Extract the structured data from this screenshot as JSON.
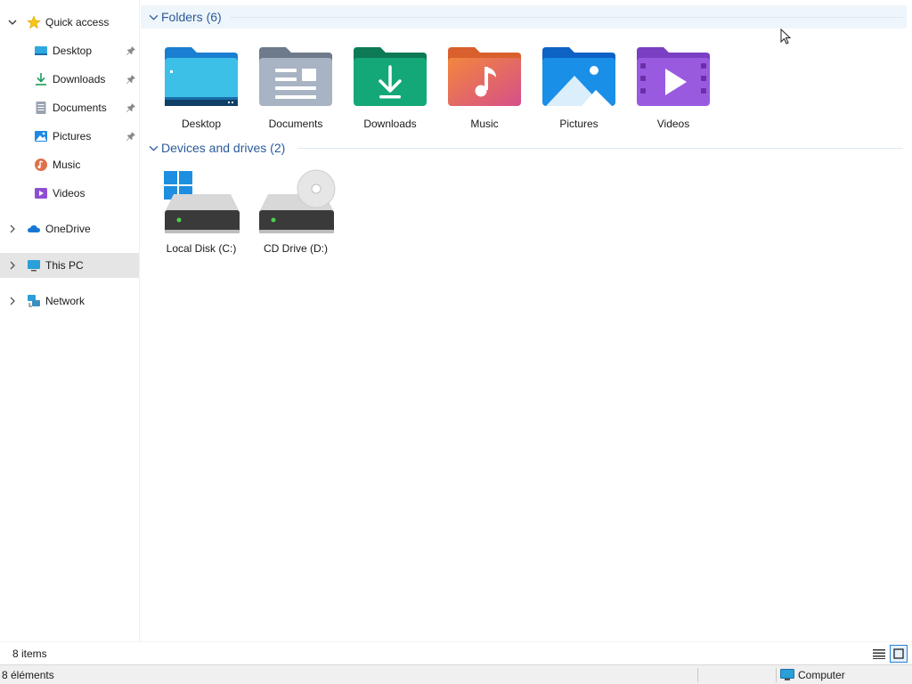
{
  "sidebar": {
    "quick_access": {
      "label": "Quick access",
      "icon": "star-icon",
      "expanded": true
    },
    "pinned": [
      {
        "label": "Desktop",
        "icon": "desktop-icon"
      },
      {
        "label": "Downloads",
        "icon": "downloads-icon"
      },
      {
        "label": "Documents",
        "icon": "documents-icon"
      },
      {
        "label": "Pictures",
        "icon": "pictures-icon"
      },
      {
        "label": "Music",
        "icon": "music-icon"
      },
      {
        "label": "Videos",
        "icon": "videos-icon"
      }
    ],
    "onedrive": {
      "label": "OneDrive",
      "icon": "cloud-icon"
    },
    "this_pc": {
      "label": "This PC",
      "icon": "monitor-icon",
      "selected": true
    },
    "network": {
      "label": "Network",
      "icon": "network-icon"
    }
  },
  "main": {
    "folders_group": {
      "title": "Folders (6)"
    },
    "folders": [
      {
        "label": "Desktop"
      },
      {
        "label": "Documents"
      },
      {
        "label": "Downloads"
      },
      {
        "label": "Music"
      },
      {
        "label": "Pictures"
      },
      {
        "label": "Videos"
      }
    ],
    "devices_group": {
      "title": "Devices and drives (2)"
    },
    "drives": [
      {
        "label": "Local Disk (C:)"
      },
      {
        "label": "CD Drive (D:)"
      }
    ]
  },
  "status": {
    "item_count": "8 items",
    "bottom_count": "8 éléments",
    "zone_label": "Computer"
  },
  "colors": {
    "accent": "#2a5b9a",
    "selection": "#e5e5e5"
  }
}
